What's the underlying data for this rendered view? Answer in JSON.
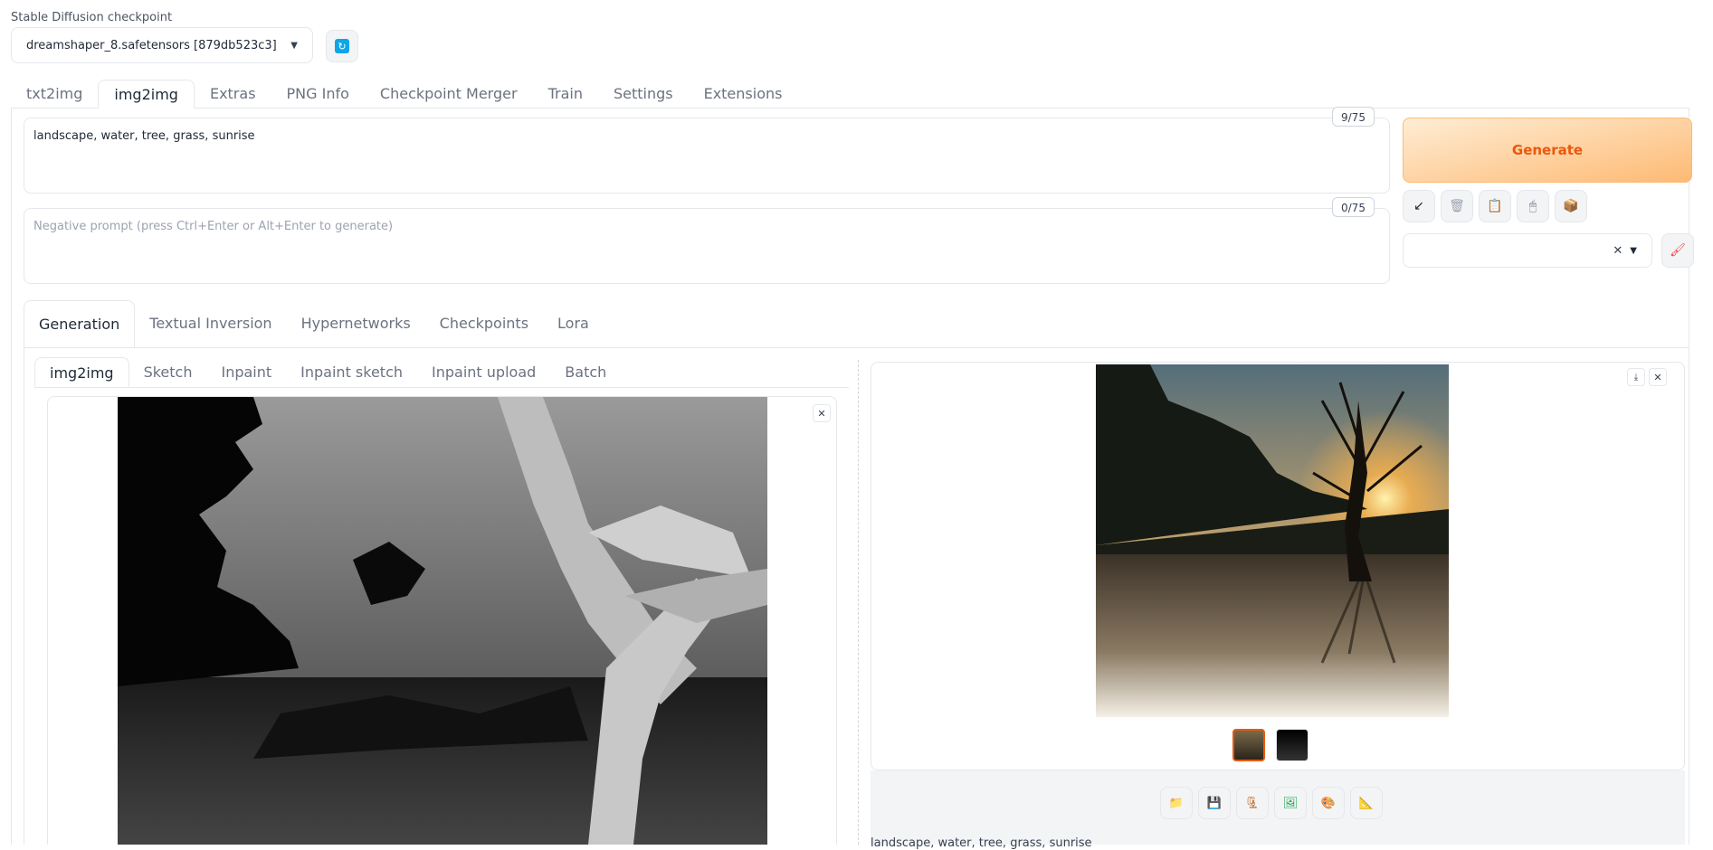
{
  "checkpoint": {
    "label": "Stable Diffusion checkpoint",
    "value": "dreamshaper_8.safetensors [879db523c3]"
  },
  "main_tabs": [
    {
      "label": "txt2img"
    },
    {
      "label": "img2img"
    },
    {
      "label": "Extras"
    },
    {
      "label": "PNG Info"
    },
    {
      "label": "Checkpoint Merger"
    },
    {
      "label": "Train"
    },
    {
      "label": "Settings"
    },
    {
      "label": "Extensions"
    }
  ],
  "prompt": {
    "value": "landscape, water, tree, grass, sunrise",
    "token_count": "9/75"
  },
  "negative_prompt": {
    "placeholder": "Negative prompt (press Ctrl+Enter or Alt+Enter to generate)",
    "token_count": "0/75"
  },
  "generate_label": "Generate",
  "tool_icons": [
    "arrow-icon",
    "trash-icon",
    "clipboard-icon",
    "clip-icon",
    "package-icon"
  ],
  "sub_tabs": [
    {
      "label": "Generation"
    },
    {
      "label": "Textual Inversion"
    },
    {
      "label": "Hypernetworks"
    },
    {
      "label": "Checkpoints"
    },
    {
      "label": "Lora"
    }
  ],
  "img_tabs": [
    {
      "label": "img2img"
    },
    {
      "label": "Sketch"
    },
    {
      "label": "Inpaint"
    },
    {
      "label": "Inpaint sketch"
    },
    {
      "label": "Inpaint upload"
    },
    {
      "label": "Batch"
    }
  ],
  "output": {
    "info": "landscape, water, tree, grass, sunrise"
  },
  "action_icons": [
    "folder-icon",
    "save-icon",
    "zip-icon",
    "image-icon",
    "palette-icon",
    "ruler-icon"
  ],
  "colors": {
    "accent": "#ea580c",
    "generate_bg": "#fdba74",
    "refresh": "#0ea5e9"
  }
}
